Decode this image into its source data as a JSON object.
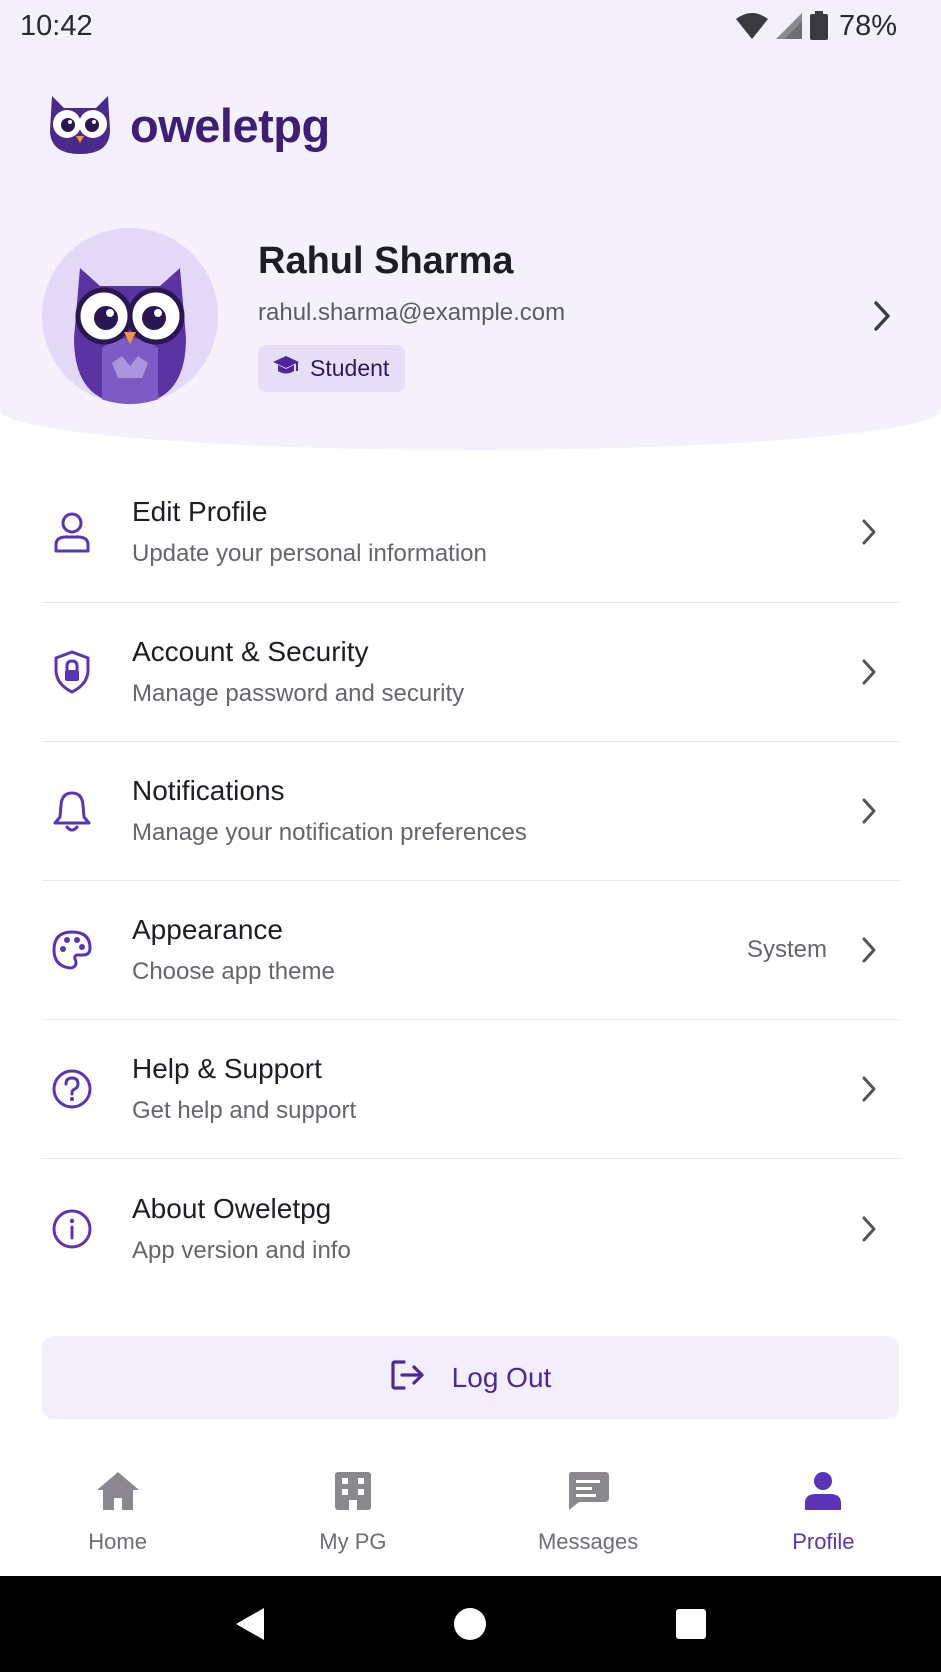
{
  "status_bar": {
    "time": "10:42",
    "battery_pct": "78%",
    "icons": [
      "wifi-icon",
      "signal-icon",
      "battery-icon"
    ]
  },
  "brand": {
    "name": "oweletpg",
    "logo": "owl-logo-icon"
  },
  "profile": {
    "name": "Rahul Sharma",
    "email": "rahul.sharma@example.com",
    "role": "Student",
    "role_icon": "graduation-cap-icon",
    "avatar": "owl-avatar"
  },
  "menu": {
    "items": [
      {
        "title": "Edit Profile",
        "subtitle": "Update your personal information",
        "icon": "person-icon"
      },
      {
        "title": "Account & Security",
        "subtitle": "Manage password and security",
        "icon": "shield-lock-icon"
      },
      {
        "title": "Notifications",
        "subtitle": "Manage your notification preferences",
        "icon": "bell-icon"
      },
      {
        "title": "Appearance",
        "subtitle": "Choose app theme",
        "value": "System",
        "icon": "palette-icon"
      },
      {
        "title": "Help & Support",
        "subtitle": "Get help and support",
        "icon": "help-circle-icon"
      },
      {
        "title": "About Oweletpg",
        "subtitle": "App version and info",
        "icon": "info-circle-icon"
      }
    ]
  },
  "logout": {
    "label": "Log Out",
    "icon": "logout-icon"
  },
  "bottom_nav": {
    "items": [
      {
        "label": "Home",
        "icon": "home-icon",
        "active": false
      },
      {
        "label": "My PG",
        "icon": "building-icon",
        "active": false
      },
      {
        "label": "Messages",
        "icon": "message-icon",
        "active": false
      },
      {
        "label": "Profile",
        "icon": "person-filled-icon",
        "active": true
      }
    ]
  },
  "colors": {
    "accent": "#5a34b6",
    "brand_dark": "#3b1e78",
    "header_bg": "#f3effb",
    "badge_bg": "#e7def7",
    "nav_inactive": "#8a878f"
  }
}
